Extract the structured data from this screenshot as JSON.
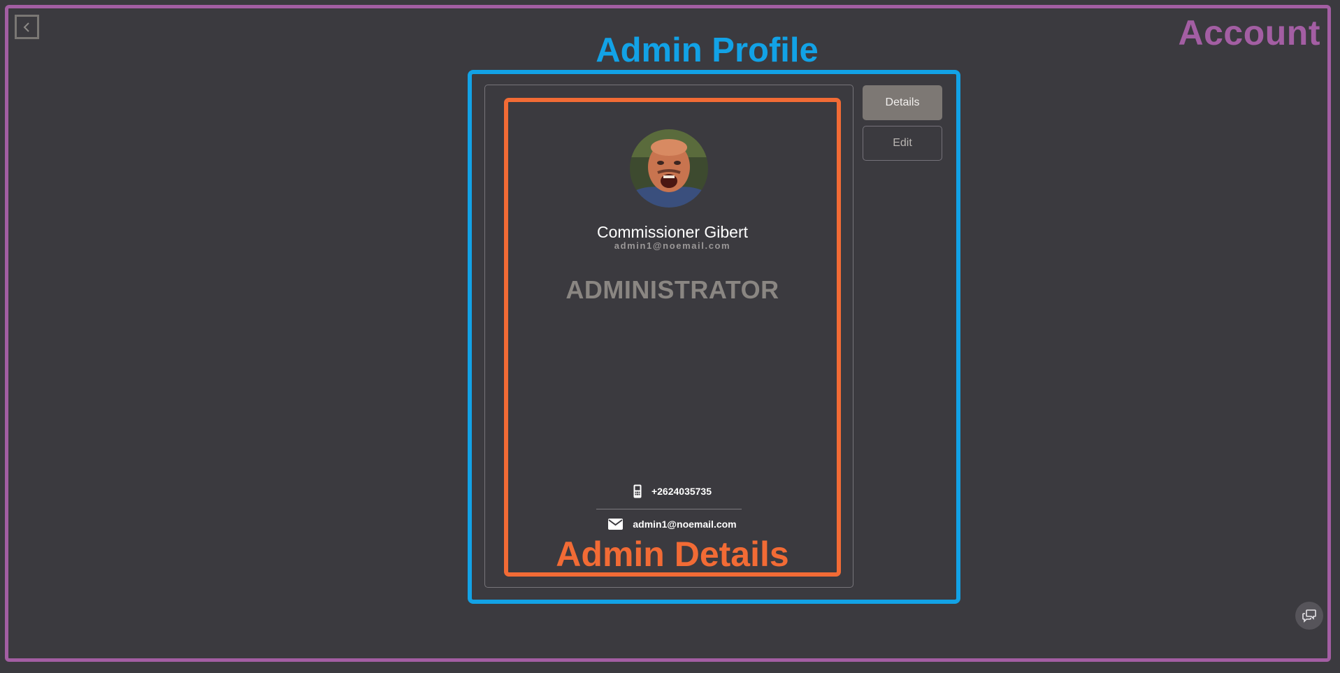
{
  "annotations": {
    "account_label": "Account",
    "profile_label": "Admin Profile",
    "details_label": "Admin Details"
  },
  "nav": {
    "back_icon": "chevron-left-icon"
  },
  "profile": {
    "name": "Commissioner Gibert",
    "email_sub": "admin1@noemail.com",
    "role": "ADMINISTRATOR",
    "phone": "+2624035735",
    "email": "admin1@noemail.com",
    "phone_icon": "mobile-phone-icon",
    "email_icon": "envelope-icon"
  },
  "tabs": [
    {
      "label": "Details",
      "active": true
    },
    {
      "label": "Edit",
      "active": false
    }
  ],
  "colors": {
    "background": "#3b3a3f",
    "account_frame": "#a35ea3",
    "profile_frame": "#12a2e6",
    "details_frame": "#f26b35",
    "tab_active": "#7d7874"
  },
  "chat": {
    "icon": "chat-bubbles-icon"
  }
}
